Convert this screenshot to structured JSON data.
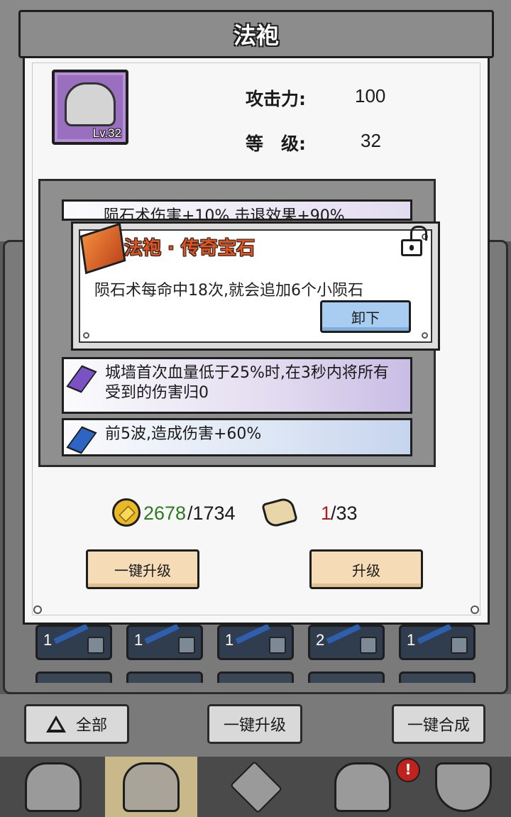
{
  "dialog": {
    "title": "法袍",
    "item": {
      "level_badge": "Lv.32"
    },
    "stats": {
      "attack_label": "攻击力:",
      "attack_value": "100",
      "level_label": "等　级:",
      "level_value": "32"
    },
    "gems": {
      "partial_row_text": "陨石术伤害+10%,击退效果+90%",
      "rows": [
        {
          "text": "城墙首次血量低于25%时,在3秒内将所有受到的伤害归0",
          "color": "#7b52c3"
        },
        {
          "text": "前5波,造成伤害+60%",
          "color": "#2e64c2"
        }
      ]
    },
    "tooltip": {
      "title": "法袍 · 传奇宝石",
      "description": "陨石术每命中18次,就会追加6个小陨石",
      "unload_label": "卸下"
    },
    "resources": {
      "coins_have": "2678",
      "coins_need": "/1734",
      "scrolls_have": "1",
      "scrolls_need": "/33"
    },
    "buttons": {
      "one_key_upgrade": "一键升级",
      "upgrade": "升级"
    }
  },
  "inventory": {
    "counts": [
      "1",
      "1",
      "1",
      "2",
      "1"
    ]
  },
  "bottom_bar": {
    "all_label": "全部",
    "one_key_upgrade_label": "一键升级",
    "one_key_merge_label": "一键合成"
  },
  "tabs": {
    "alert_badge": "!"
  },
  "colors": {
    "coins_have": "#2d7a1f",
    "scrolls_have": "#b21b1b",
    "tooltip_title": "#e0541f"
  }
}
